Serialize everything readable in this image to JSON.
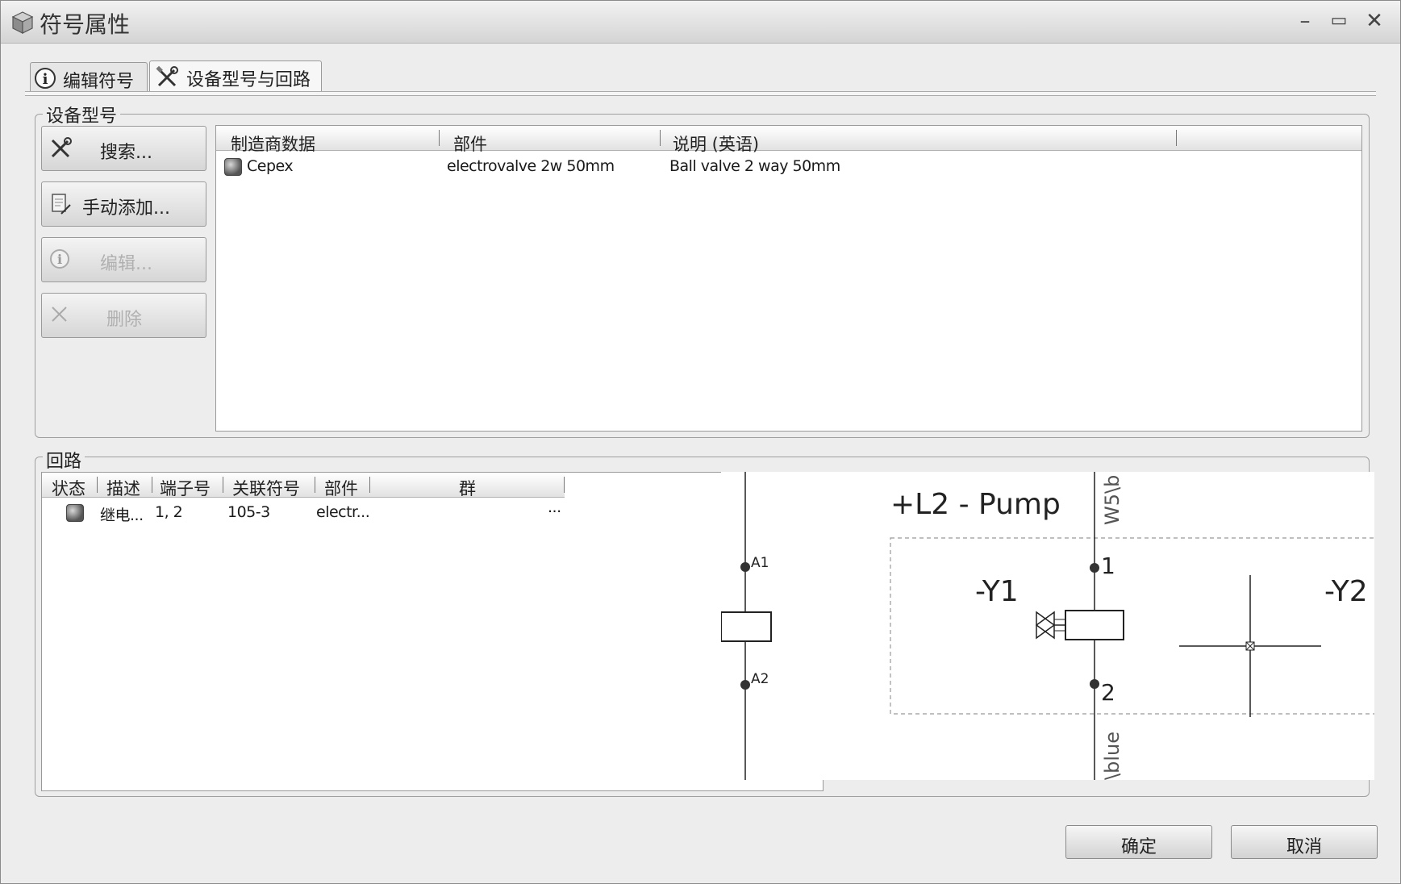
{
  "window": {
    "title": "符号属性",
    "minimize": "–",
    "maximize": "▭",
    "close": "✕"
  },
  "tabs": [
    {
      "label": "编辑符号",
      "icon": "info-icon"
    },
    {
      "label": "设备型号与回路",
      "icon": "tools-icon",
      "active": true
    }
  ],
  "device_group": {
    "title": "设备型号",
    "buttons": [
      {
        "label": "搜索...",
        "icon": "tools-icon",
        "enabled": true
      },
      {
        "label": "手动添加...",
        "icon": "add-document-icon",
        "enabled": true
      },
      {
        "label": "编辑...",
        "icon": "info-icon",
        "enabled": false
      },
      {
        "label": "删除",
        "icon": "delete-x-icon",
        "enabled": false
      }
    ],
    "columns": [
      "制造商数据",
      "部件",
      "说明 (英语)"
    ],
    "rows": [
      {
        "manufacturer": "Cepex",
        "part": "electrovalve 2w 50mm",
        "description": "Ball valve 2 way 50mm"
      }
    ]
  },
  "circuit_group": {
    "title": "回路",
    "columns": [
      "状态",
      "描述",
      "端子号",
      "关联符号",
      "部件",
      "群"
    ],
    "rows": [
      {
        "description": "继电...",
        "terminals": "1, 2",
        "related_symbol": "105-3",
        "part": "electr...",
        "group": "..."
      }
    ]
  },
  "diagram": {
    "location_label": "+L2 - Pump",
    "wire_top": "W5\\b",
    "wire_bottom": "\\blue",
    "left_pin_top": "A1",
    "left_pin_bottom": "A2",
    "device_y1": "-Y1",
    "device_y2": "-Y2",
    "pin_top": "1",
    "pin_bottom": "2"
  },
  "footer": {
    "ok": "确定",
    "cancel": "取消"
  }
}
